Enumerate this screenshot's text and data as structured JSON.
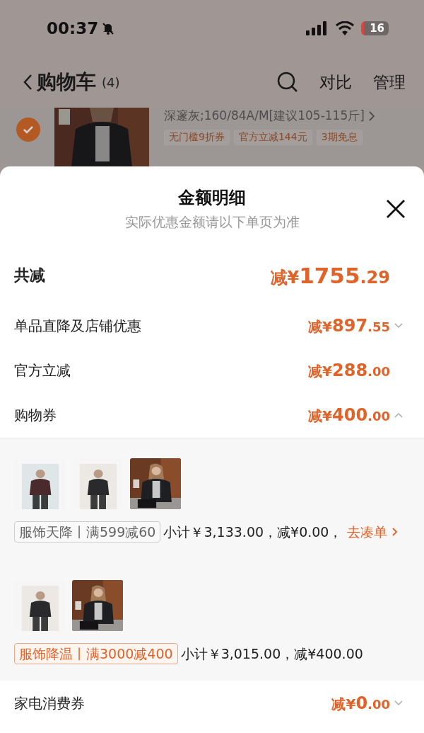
{
  "status_bar": {
    "time": "00:37",
    "battery": "16",
    "muted": true
  },
  "nav": {
    "title": "购物车",
    "count": "(4)",
    "actions": [
      "对比",
      "管理"
    ]
  },
  "cart_item": {
    "checked": true,
    "variant": "深邃灰;160/84A/M[建议105-115斤]",
    "tags": [
      "无门槛9折券",
      "官方立减144元",
      "3期免息"
    ]
  },
  "sheet": {
    "title": "金额明细",
    "subtitle": "实际优惠金额请以下单页为准",
    "rows": [
      {
        "kind": "total",
        "label": "共减",
        "amount": "减¥1755.29"
      },
      {
        "kind": "line",
        "label": "单品直降及店铺优惠",
        "amount": "减¥897.55",
        "expanded": false
      },
      {
        "kind": "line",
        "label": "官方立减",
        "amount": "减¥288.00"
      },
      {
        "kind": "line",
        "label": "购物券",
        "amount": "减¥400.00",
        "expanded": true
      }
    ],
    "coupon_groups": [
      {
        "tag": "服饰天降丨满599减60",
        "met": false,
        "summary": "小计￥3,133.00，减¥0.00，",
        "link": "去凑单"
      },
      {
        "tag": "服饰降温丨满3000减400",
        "met": true,
        "summary": "小计￥3,015.00，减¥400.00"
      }
    ],
    "footer_row": {
      "label": "家电消费券",
      "amount": "减¥0.00",
      "expanded": false
    }
  }
}
